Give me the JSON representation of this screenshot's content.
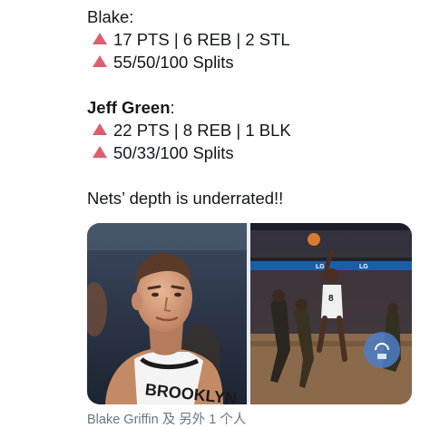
{
  "tweet": {
    "player1_name": "Blake:",
    "player1_stats": "17 PTS | 6 REB | 2 STL",
    "player1_splits": "55/50/100 Splits",
    "player2_name": "Jeff Green",
    "player2_colon": ":",
    "player2_stats": "22 PTS | 8 REB | 1 BLK",
    "player2_splits": "50/33/100 Splits",
    "closing": "Nets’ depth is underrated!!"
  },
  "media": {
    "photo1_jersey_text": "BROOKLYN",
    "photo2_jersey_number": "8",
    "photo2_board_text": "LG",
    "caption": "Blake Griffin 及 另外 1 个人"
  },
  "colors": {
    "up_arrow": "#dd5f6e",
    "text": "#14171a",
    "caption": "#657786"
  },
  "icons": {
    "stat_up": "red-triangle-up-icon"
  }
}
